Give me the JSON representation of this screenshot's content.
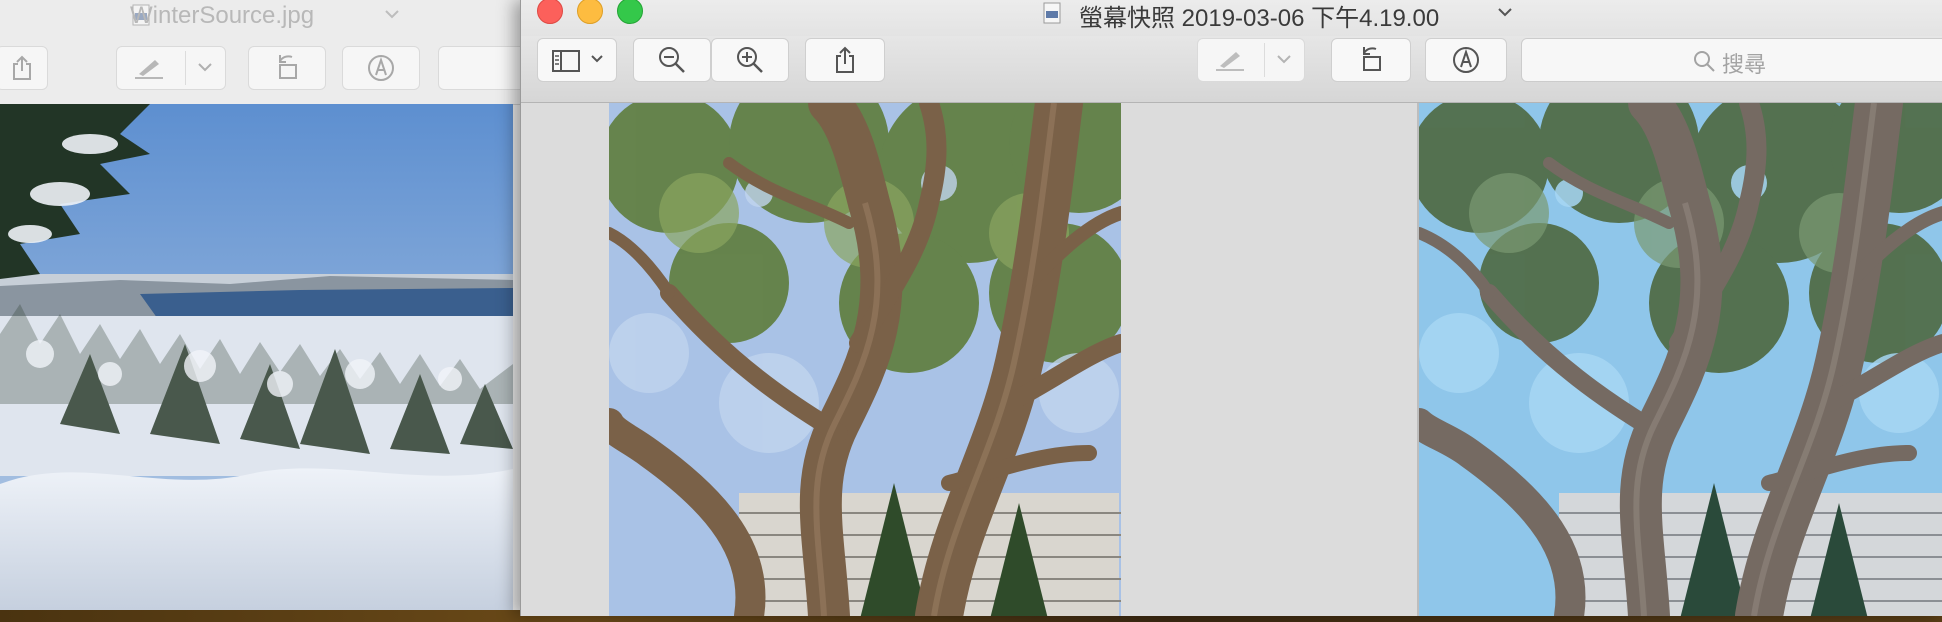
{
  "back_window": {
    "title": "WinterSource.jpg",
    "toolbar": {
      "icons": [
        "share-icon",
        "markup-pen-icon",
        "chevron-down-icon",
        "rotate-left-icon",
        "annotate-icon"
      ]
    }
  },
  "front_window": {
    "title": "螢幕快照 2019-03-06 下午4.19.00",
    "search": {
      "placeholder": "搜尋"
    },
    "toolbar": {
      "icons": [
        "sidebar-icon",
        "zoom-out-icon",
        "zoom-in-icon",
        "share-icon",
        "markup-pen-icon",
        "rotate-left-icon",
        "annotate-icon",
        "search-icon"
      ]
    }
  },
  "colors": {
    "traffic_close": "#fc605b",
    "traffic_minimize": "#fdbc40",
    "traffic_zoom": "#34c84a"
  }
}
